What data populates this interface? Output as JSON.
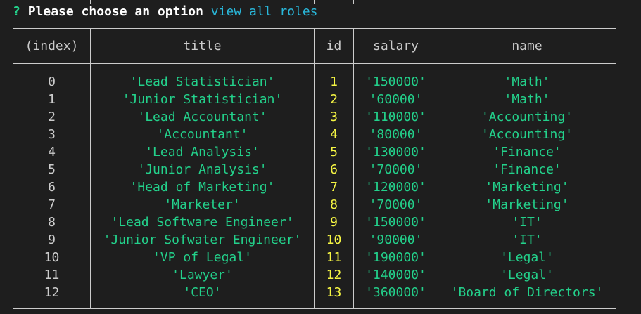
{
  "prompt": {
    "mark": "?",
    "question": "Please choose an option",
    "answer": "view all roles"
  },
  "table": {
    "headers": [
      "(index)",
      "title",
      "id",
      "salary",
      "name"
    ],
    "rows": [
      [
        "0",
        "'Lead Statistician'",
        "1",
        "'150000'",
        "'Math'"
      ],
      [
        "1",
        "'Junior Statistician'",
        "2",
        "'60000'",
        "'Math'"
      ],
      [
        "2",
        "'Lead Accountant'",
        "3",
        "'110000'",
        "'Accounting'"
      ],
      [
        "3",
        "'Accountant'",
        "4",
        "'80000'",
        "'Accounting'"
      ],
      [
        "4",
        "'Lead Analysis'",
        "5",
        "'130000'",
        "'Finance'"
      ],
      [
        "5",
        "'Junior Analysis'",
        "6",
        "'70000'",
        "'Finance'"
      ],
      [
        "6",
        "'Head of Marketing'",
        "7",
        "'120000'",
        "'Marketing'"
      ],
      [
        "7",
        "'Marketer'",
        "8",
        "'70000'",
        "'Marketing'"
      ],
      [
        "8",
        "'Lead Software Engineer'",
        "9",
        "'150000'",
        "'IT'"
      ],
      [
        "9",
        "'Junior Sofwater Engineer'",
        "10",
        "'90000'",
        "'IT'"
      ],
      [
        "10",
        "'VP of Legal'",
        "11",
        "'190000'",
        "'Legal'"
      ],
      [
        "11",
        "'Lawyer'",
        "12",
        "'140000'",
        "'Legal'"
      ],
      [
        "12",
        "'CEO'",
        "13",
        "'360000'",
        "'Board of Directors'"
      ]
    ]
  },
  "colors": {
    "background": "#1e1e1e",
    "string": "#23d18b",
    "number": "#f5f543",
    "prompt_answer": "#29b8db"
  }
}
